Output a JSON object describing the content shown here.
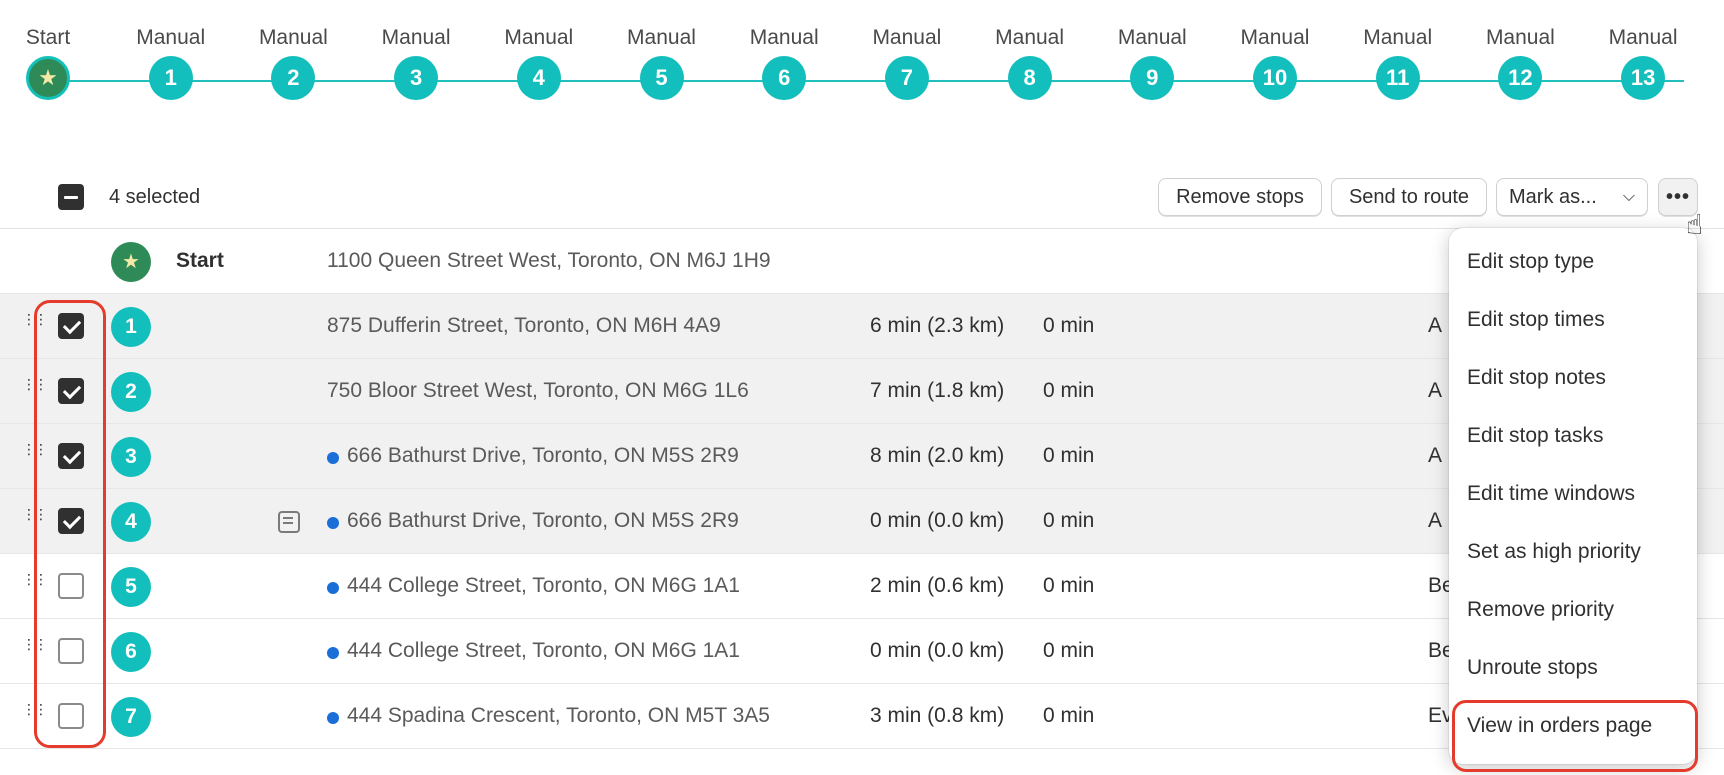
{
  "timeline": {
    "start_label": "Start",
    "stops": [
      {
        "label": "Manual",
        "number": "1"
      },
      {
        "label": "Manual",
        "number": "2"
      },
      {
        "label": "Manual",
        "number": "3"
      },
      {
        "label": "Manual",
        "number": "4"
      },
      {
        "label": "Manual",
        "number": "5"
      },
      {
        "label": "Manual",
        "number": "6"
      },
      {
        "label": "Manual",
        "number": "7"
      },
      {
        "label": "Manual",
        "number": "8"
      },
      {
        "label": "Manual",
        "number": "9"
      },
      {
        "label": "Manual",
        "number": "10"
      },
      {
        "label": "Manual",
        "number": "11"
      },
      {
        "label": "Manual",
        "number": "12"
      },
      {
        "label": "Manual",
        "number": "13"
      }
    ]
  },
  "toolbar": {
    "selected_text": "4 selected",
    "remove_stops": "Remove stops",
    "send_to_route": "Send to route",
    "mark_as": "Mark as...",
    "more": "•••"
  },
  "start_row": {
    "label": "Start",
    "address": "1100 Queen Street West, Toronto, ON M6J 1H9"
  },
  "rows": [
    {
      "num": "1",
      "checked": true,
      "has_dot": false,
      "has_note": false,
      "address": "875 Dufferin Street, Toronto, ON M6H 4A9",
      "travel": "6 min (2.3 km)",
      "service": "0 min",
      "status": "A"
    },
    {
      "num": "2",
      "checked": true,
      "has_dot": false,
      "has_note": false,
      "address": "750 Bloor Street West, Toronto, ON M6G 1L6",
      "travel": "7 min (1.8 km)",
      "service": "0 min",
      "status": "A"
    },
    {
      "num": "3",
      "checked": true,
      "has_dot": true,
      "has_note": false,
      "address": "666 Bathurst Drive, Toronto, ON M5S 2R9",
      "travel": "8 min (2.0 km)",
      "service": "0 min",
      "status": "A"
    },
    {
      "num": "4",
      "checked": true,
      "has_dot": true,
      "has_note": true,
      "address": "666 Bathurst Drive, Toronto, ON M5S 2R9",
      "travel": "0 min (0.0 km)",
      "service": "0 min",
      "status": "A"
    },
    {
      "num": "5",
      "checked": false,
      "has_dot": true,
      "has_note": false,
      "address": "444 College Street, Toronto, ON M6G 1A1",
      "travel": "2 min (0.6 km)",
      "service": "0 min",
      "status": "Be"
    },
    {
      "num": "6",
      "checked": false,
      "has_dot": true,
      "has_note": false,
      "address": "444 College Street, Toronto, ON M6G 1A1",
      "travel": "0 min (0.0 km)",
      "service": "0 min",
      "status": "Be"
    },
    {
      "num": "7",
      "checked": false,
      "has_dot": true,
      "has_note": false,
      "address": "444 Spadina Crescent, Toronto, ON M5T 3A5",
      "travel": "3 min (0.8 km)",
      "service": "0 min",
      "status": "Ev"
    }
  ],
  "menu": {
    "items": [
      "Edit stop type",
      "Edit stop times",
      "Edit stop notes",
      "Edit stop tasks",
      "Edit time windows",
      "Set as high priority",
      "Remove priority",
      "Unroute stops",
      "View in orders page"
    ],
    "highlighted": "View in orders page"
  },
  "colors": {
    "accent_teal": "#12bfbc",
    "start_green": "#2e8b57",
    "highlight_red": "#e53b2c",
    "dot_blue": "#1a6ed8"
  }
}
